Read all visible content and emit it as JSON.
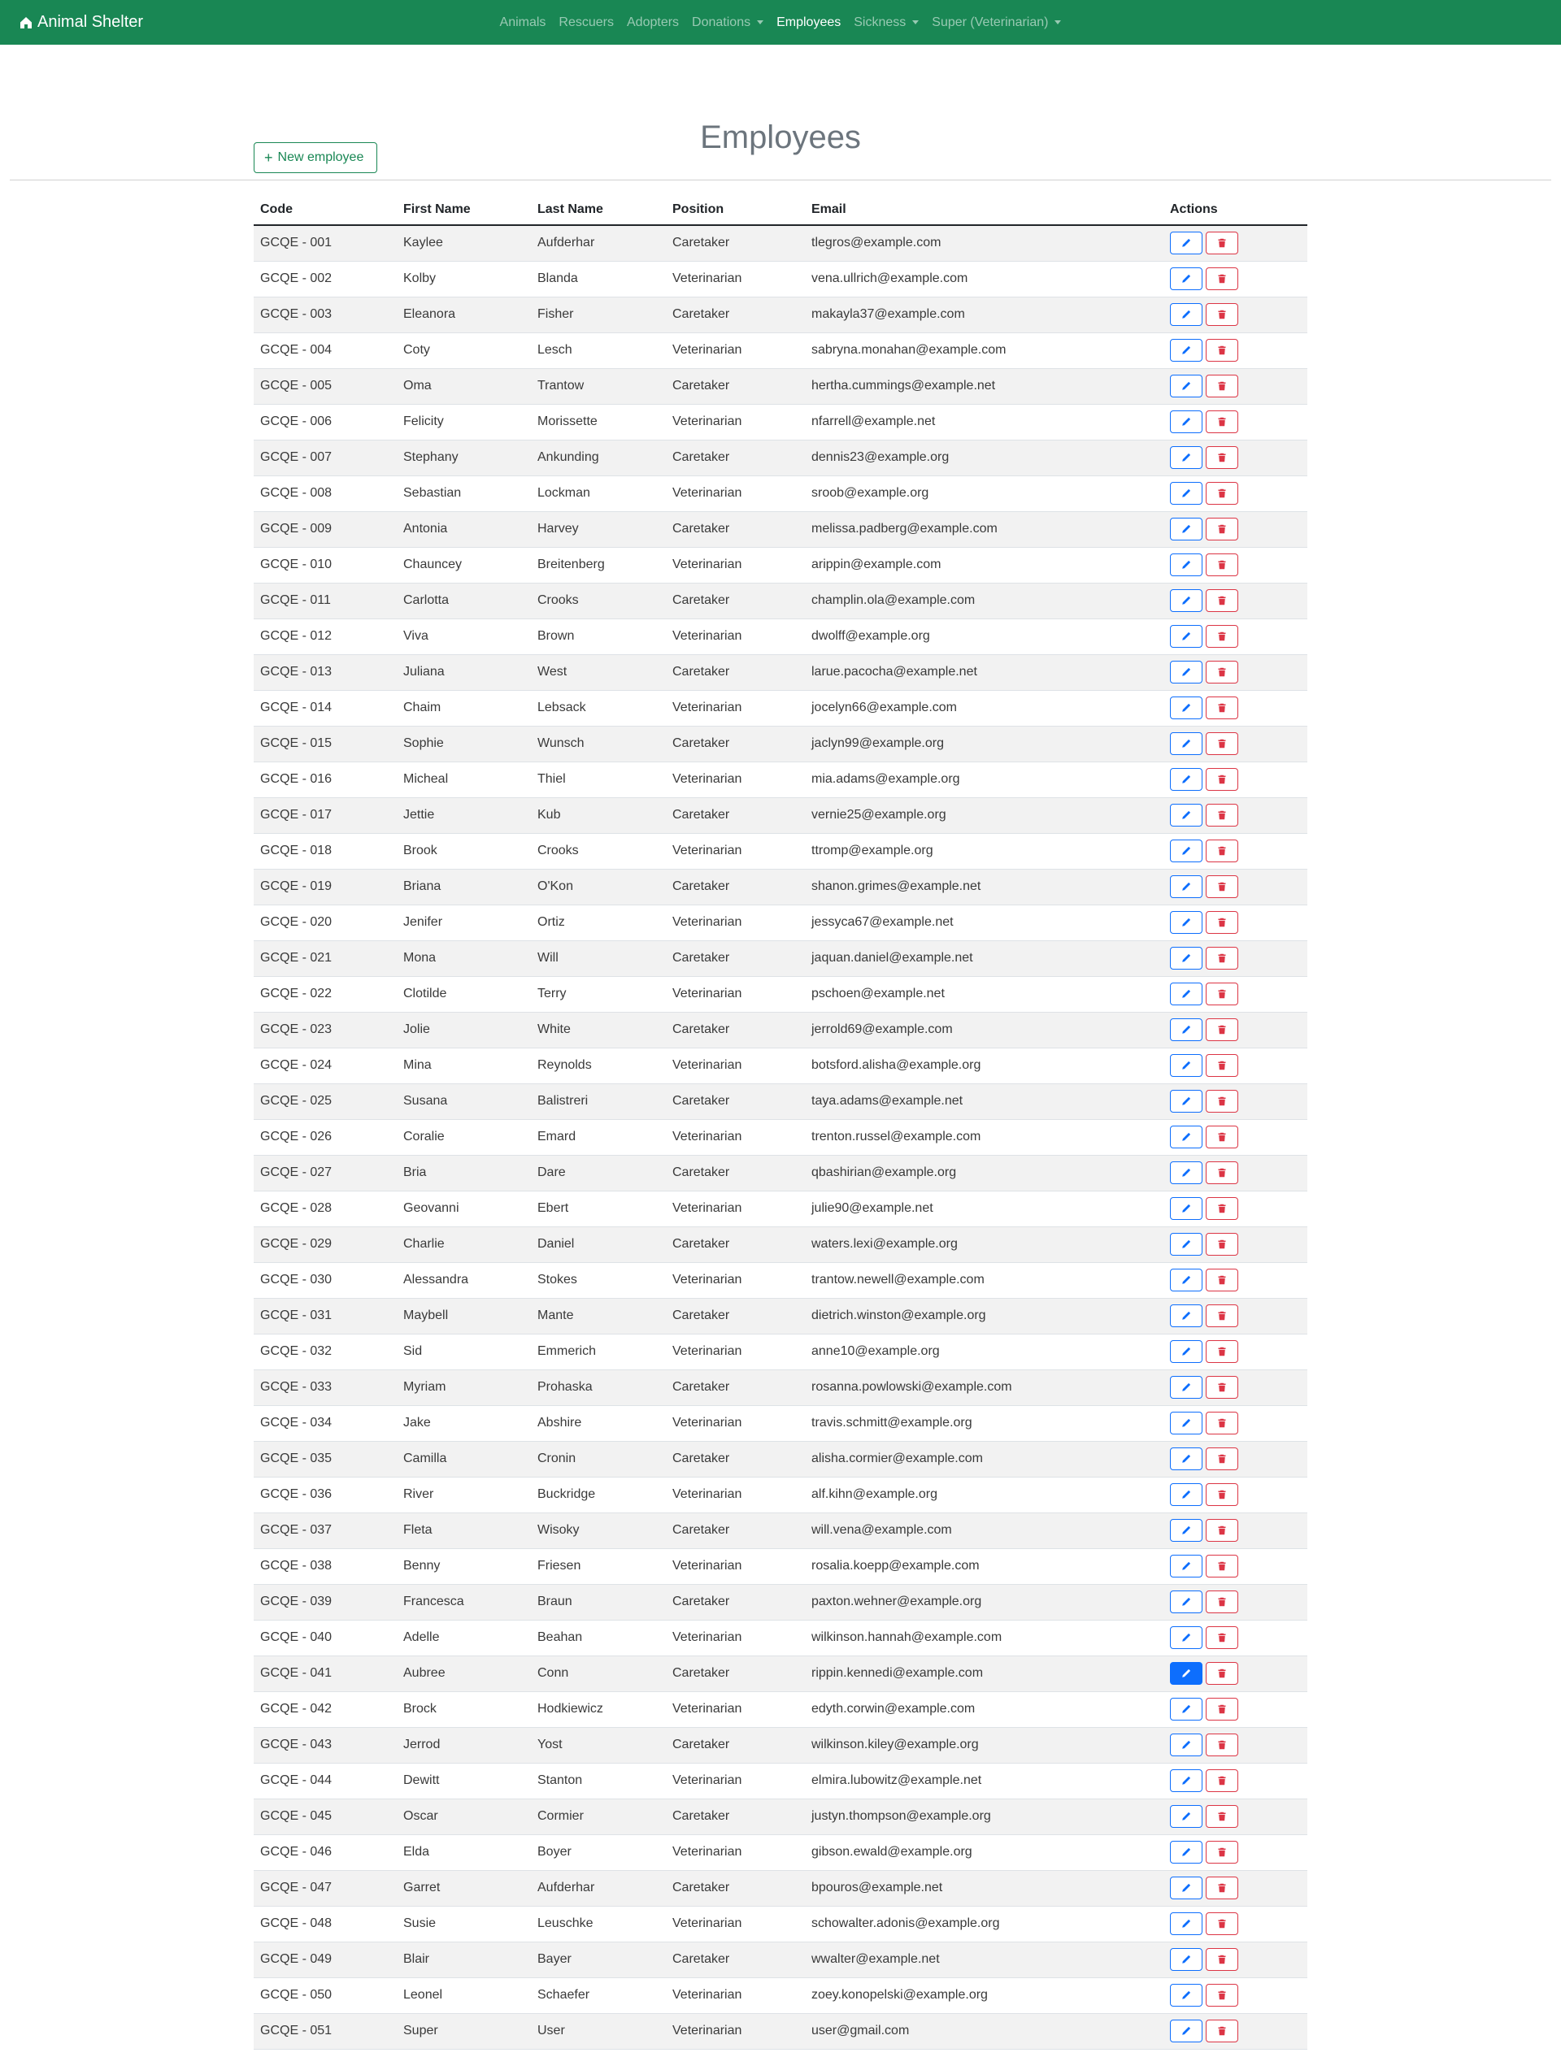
{
  "brand": {
    "name": "Animal Shelter",
    "icon": "home-icon"
  },
  "nav": [
    {
      "label": "Animals",
      "dropdown": false,
      "active": false
    },
    {
      "label": "Rescuers",
      "dropdown": false,
      "active": false
    },
    {
      "label": "Adopters",
      "dropdown": false,
      "active": false
    },
    {
      "label": "Donations",
      "dropdown": true,
      "active": false
    },
    {
      "label": "Employees",
      "dropdown": false,
      "active": true
    },
    {
      "label": "Sickness",
      "dropdown": true,
      "active": false
    },
    {
      "label": "Super (Veterinarian)",
      "dropdown": true,
      "active": false
    }
  ],
  "page": {
    "title": "Employees",
    "new_button": "New employee",
    "new_button_icon": "plus-icon"
  },
  "table": {
    "headers": {
      "code": "Code",
      "first": "First Name",
      "last": "Last Name",
      "position": "Position",
      "email": "Email",
      "actions": "Actions"
    },
    "action_icons": {
      "edit": "pencil-icon",
      "delete": "trash-icon"
    },
    "colors": {
      "edit": "#0d6efd",
      "delete": "#dc3545",
      "navbar": "#198754"
    },
    "rows": [
      {
        "code": "GCQE - 001",
        "first": "Kaylee",
        "last": "Aufderhar",
        "position": "Caretaker",
        "email": "tlegros@example.com"
      },
      {
        "code": "GCQE - 002",
        "first": "Kolby",
        "last": "Blanda",
        "position": "Veterinarian",
        "email": "vena.ullrich@example.com"
      },
      {
        "code": "GCQE - 003",
        "first": "Eleanora",
        "last": "Fisher",
        "position": "Caretaker",
        "email": "makayla37@example.com"
      },
      {
        "code": "GCQE - 004",
        "first": "Coty",
        "last": "Lesch",
        "position": "Veterinarian",
        "email": "sabryna.monahan@example.com"
      },
      {
        "code": "GCQE - 005",
        "first": "Oma",
        "last": "Trantow",
        "position": "Caretaker",
        "email": "hertha.cummings@example.net"
      },
      {
        "code": "GCQE - 006",
        "first": "Felicity",
        "last": "Morissette",
        "position": "Veterinarian",
        "email": "nfarrell@example.net"
      },
      {
        "code": "GCQE - 007",
        "first": "Stephany",
        "last": "Ankunding",
        "position": "Caretaker",
        "email": "dennis23@example.org"
      },
      {
        "code": "GCQE - 008",
        "first": "Sebastian",
        "last": "Lockman",
        "position": "Veterinarian",
        "email": "sroob@example.org"
      },
      {
        "code": "GCQE - 009",
        "first": "Antonia",
        "last": "Harvey",
        "position": "Caretaker",
        "email": "melissa.padberg@example.com"
      },
      {
        "code": "GCQE - 010",
        "first": "Chauncey",
        "last": "Breitenberg",
        "position": "Veterinarian",
        "email": "arippin@example.com"
      },
      {
        "code": "GCQE - 011",
        "first": "Carlotta",
        "last": "Crooks",
        "position": "Caretaker",
        "email": "champlin.ola@example.com"
      },
      {
        "code": "GCQE - 012",
        "first": "Viva",
        "last": "Brown",
        "position": "Veterinarian",
        "email": "dwolff@example.org"
      },
      {
        "code": "GCQE - 013",
        "first": "Juliana",
        "last": "West",
        "position": "Caretaker",
        "email": "larue.pacocha@example.net"
      },
      {
        "code": "GCQE - 014",
        "first": "Chaim",
        "last": "Lebsack",
        "position": "Veterinarian",
        "email": "jocelyn66@example.com"
      },
      {
        "code": "GCQE - 015",
        "first": "Sophie",
        "last": "Wunsch",
        "position": "Caretaker",
        "email": "jaclyn99@example.org"
      },
      {
        "code": "GCQE - 016",
        "first": "Micheal",
        "last": "Thiel",
        "position": "Veterinarian",
        "email": "mia.adams@example.org"
      },
      {
        "code": "GCQE - 017",
        "first": "Jettie",
        "last": "Kub",
        "position": "Caretaker",
        "email": "vernie25@example.org"
      },
      {
        "code": "GCQE - 018",
        "first": "Brook",
        "last": "Crooks",
        "position": "Veterinarian",
        "email": "ttromp@example.org"
      },
      {
        "code": "GCQE - 019",
        "first": "Briana",
        "last": "O'Kon",
        "position": "Caretaker",
        "email": "shanon.grimes@example.net"
      },
      {
        "code": "GCQE - 020",
        "first": "Jenifer",
        "last": "Ortiz",
        "position": "Veterinarian",
        "email": "jessyca67@example.net"
      },
      {
        "code": "GCQE - 021",
        "first": "Mona",
        "last": "Will",
        "position": "Caretaker",
        "email": "jaquan.daniel@example.net"
      },
      {
        "code": "GCQE - 022",
        "first": "Clotilde",
        "last": "Terry",
        "position": "Veterinarian",
        "email": "pschoen@example.net"
      },
      {
        "code": "GCQE - 023",
        "first": "Jolie",
        "last": "White",
        "position": "Caretaker",
        "email": "jerrold69@example.com"
      },
      {
        "code": "GCQE - 024",
        "first": "Mina",
        "last": "Reynolds",
        "position": "Veterinarian",
        "email": "botsford.alisha@example.org"
      },
      {
        "code": "GCQE - 025",
        "first": "Susana",
        "last": "Balistreri",
        "position": "Caretaker",
        "email": "taya.adams@example.net"
      },
      {
        "code": "GCQE - 026",
        "first": "Coralie",
        "last": "Emard",
        "position": "Veterinarian",
        "email": "trenton.russel@example.com"
      },
      {
        "code": "GCQE - 027",
        "first": "Bria",
        "last": "Dare",
        "position": "Caretaker",
        "email": "qbashirian@example.org"
      },
      {
        "code": "GCQE - 028",
        "first": "Geovanni",
        "last": "Ebert",
        "position": "Veterinarian",
        "email": "julie90@example.net"
      },
      {
        "code": "GCQE - 029",
        "first": "Charlie",
        "last": "Daniel",
        "position": "Caretaker",
        "email": "waters.lexi@example.org"
      },
      {
        "code": "GCQE - 030",
        "first": "Alessandra",
        "last": "Stokes",
        "position": "Veterinarian",
        "email": "trantow.newell@example.com"
      },
      {
        "code": "GCQE - 031",
        "first": "Maybell",
        "last": "Mante",
        "position": "Caretaker",
        "email": "dietrich.winston@example.org"
      },
      {
        "code": "GCQE - 032",
        "first": "Sid",
        "last": "Emmerich",
        "position": "Veterinarian",
        "email": "anne10@example.org"
      },
      {
        "code": "GCQE - 033",
        "first": "Myriam",
        "last": "Prohaska",
        "position": "Caretaker",
        "email": "rosanna.powlowski@example.com"
      },
      {
        "code": "GCQE - 034",
        "first": "Jake",
        "last": "Abshire",
        "position": "Veterinarian",
        "email": "travis.schmitt@example.org"
      },
      {
        "code": "GCQE - 035",
        "first": "Camilla",
        "last": "Cronin",
        "position": "Caretaker",
        "email": "alisha.cormier@example.com"
      },
      {
        "code": "GCQE - 036",
        "first": "River",
        "last": "Buckridge",
        "position": "Veterinarian",
        "email": "alf.kihn@example.org"
      },
      {
        "code": "GCQE - 037",
        "first": "Fleta",
        "last": "Wisoky",
        "position": "Caretaker",
        "email": "will.vena@example.com"
      },
      {
        "code": "GCQE - 038",
        "first": "Benny",
        "last": "Friesen",
        "position": "Veterinarian",
        "email": "rosalia.koepp@example.com"
      },
      {
        "code": "GCQE - 039",
        "first": "Francesca",
        "last": "Braun",
        "position": "Caretaker",
        "email": "paxton.wehner@example.org"
      },
      {
        "code": "GCQE - 040",
        "first": "Adelle",
        "last": "Beahan",
        "position": "Veterinarian",
        "email": "wilkinson.hannah@example.com"
      },
      {
        "code": "GCQE - 041",
        "first": "Aubree",
        "last": "Conn",
        "position": "Caretaker",
        "email": "rippin.kennedi@example.com",
        "edit_hover": true
      },
      {
        "code": "GCQE - 042",
        "first": "Brock",
        "last": "Hodkiewicz",
        "position": "Veterinarian",
        "email": "edyth.corwin@example.com"
      },
      {
        "code": "GCQE - 043",
        "first": "Jerrod",
        "last": "Yost",
        "position": "Caretaker",
        "email": "wilkinson.kiley@example.org"
      },
      {
        "code": "GCQE - 044",
        "first": "Dewitt",
        "last": "Stanton",
        "position": "Veterinarian",
        "email": "elmira.lubowitz@example.net"
      },
      {
        "code": "GCQE - 045",
        "first": "Oscar",
        "last": "Cormier",
        "position": "Caretaker",
        "email": "justyn.thompson@example.org"
      },
      {
        "code": "GCQE - 046",
        "first": "Elda",
        "last": "Boyer",
        "position": "Veterinarian",
        "email": "gibson.ewald@example.org"
      },
      {
        "code": "GCQE - 047",
        "first": "Garret",
        "last": "Aufderhar",
        "position": "Caretaker",
        "email": "bpouros@example.net"
      },
      {
        "code": "GCQE - 048",
        "first": "Susie",
        "last": "Leuschke",
        "position": "Veterinarian",
        "email": "schowalter.adonis@example.org"
      },
      {
        "code": "GCQE - 049",
        "first": "Blair",
        "last": "Bayer",
        "position": "Caretaker",
        "email": "wwalter@example.net"
      },
      {
        "code": "GCQE - 050",
        "first": "Leonel",
        "last": "Schaefer",
        "position": "Veterinarian",
        "email": "zoey.konopelski@example.org"
      },
      {
        "code": "GCQE - 051",
        "first": "Super",
        "last": "User",
        "position": "Veterinarian",
        "email": "user@gmail.com"
      }
    ]
  }
}
